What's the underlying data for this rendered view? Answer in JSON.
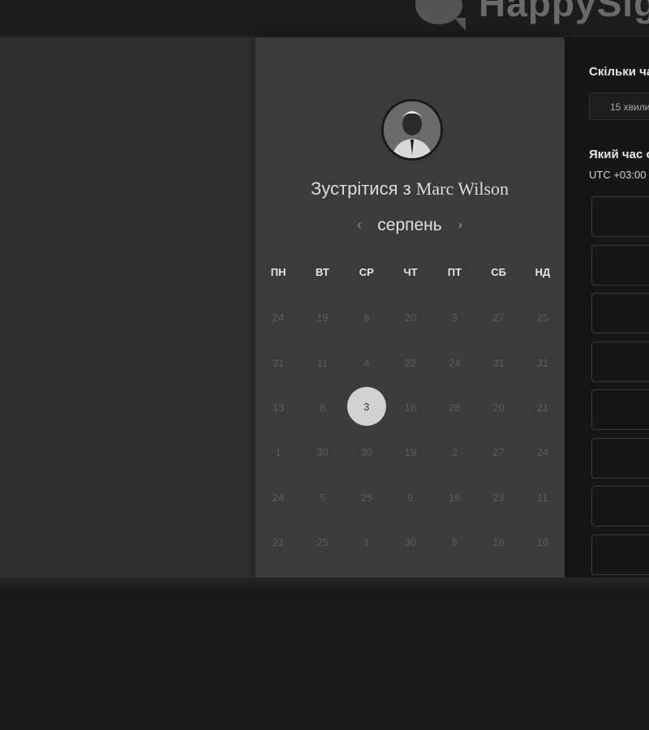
{
  "brand": {
    "name": "HappySig"
  },
  "host": {
    "prefix": "Зустрітися з",
    "name": "Marc Wilson"
  },
  "calendar": {
    "month": "серпень",
    "prev_icon": "‹",
    "next_icon": "›",
    "weekdays": [
      "ПН",
      "ВТ",
      "СР",
      "ЧТ",
      "ПТ",
      "СБ",
      "НД"
    ],
    "days": [
      "24",
      "19",
      "8",
      "20",
      "3",
      "27",
      "25",
      "31",
      "11",
      "4",
      "22",
      "24",
      "31",
      "31",
      "13",
      "8",
      "3",
      "16",
      "28",
      "20",
      "21",
      "1",
      "30",
      "30",
      "19",
      "2",
      "27",
      "24",
      "24",
      "5",
      "25",
      "9",
      "16",
      "23",
      "11",
      "21",
      "25",
      "1",
      "30",
      "5",
      "16",
      "10"
    ],
    "selected_day": "3"
  },
  "scheduler": {
    "duration_label": "Скільки ча",
    "duration_value": "15 хвили",
    "time_label": "Який час о",
    "timezone": "UTC +03:00"
  },
  "colors": {
    "page_bg": "#191919",
    "card_bg": "#3b3b3b",
    "selected_day_bg": "#d2d2d2",
    "panel_bg": "#161616"
  }
}
